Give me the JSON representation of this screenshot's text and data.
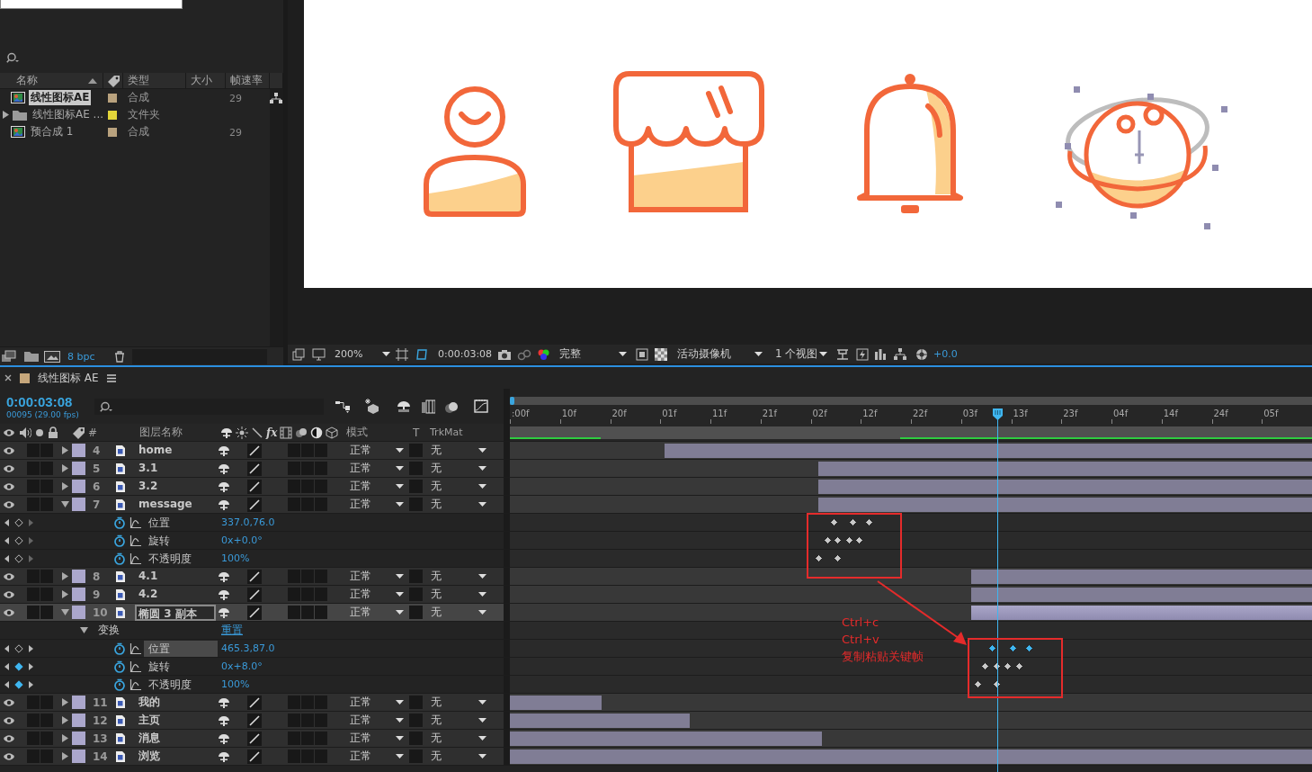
{
  "project": {
    "columns": [
      "名称",
      "类型",
      "大小",
      "帧速率"
    ],
    "items": [
      {
        "kind": "comp",
        "name": "线性图标AE",
        "type": "合成",
        "fps": "29",
        "color": "#b9a27e",
        "selected": true
      },
      {
        "kind": "folder",
        "name": "线性图标AE ...",
        "type": "文件夹",
        "color": "#e3d63a",
        "selected": false,
        "expanded": false
      },
      {
        "kind": "comp",
        "name": "预合成 1",
        "type": "合成",
        "fps": "29",
        "color": "#b9a27e",
        "selected": false
      }
    ],
    "bit_depth": "8 bpc"
  },
  "viewer": {
    "zoom": "200%",
    "timecode": "0:00:03:08",
    "resolution": "完整",
    "camera": "活动摄像机",
    "views": "1 个视图",
    "exposure": "+0.0"
  },
  "timeline": {
    "tab": "线性图标 AE",
    "timecode": "0:00:03:08",
    "frame_info": "00095 (29.00 fps)",
    "columns": {
      "number": "#",
      "name": "图层名称",
      "effects": "fx",
      "mode": "模式",
      "t": "T",
      "trkmat": "TrkMat"
    },
    "ruler": [
      ":00f",
      "10f",
      "20f",
      "01f",
      "11f",
      "21f",
      "02f",
      "12f",
      "22f",
      "03f",
      "13f",
      "23f",
      "04f",
      "14f",
      "24f",
      "05f"
    ],
    "playhead": {
      "level": 0.608
    },
    "rows": [
      {
        "kind": "layer",
        "number": "4",
        "name": "home",
        "expanded": false,
        "selected": false,
        "renaming": false,
        "mode": "正常",
        "trkmat": "无",
        "bar": {
          "level": 0.807,
          "from_end": true
        }
      },
      {
        "kind": "layer",
        "number": "5",
        "name": "3.1",
        "expanded": false,
        "selected": false,
        "renaming": false,
        "mode": "正常",
        "trkmat": "无",
        "bar": {
          "level": 0.615,
          "from_end": true
        }
      },
      {
        "kind": "layer",
        "number": "6",
        "name": "3.2",
        "expanded": false,
        "selected": false,
        "renaming": false,
        "mode": "正常",
        "trkmat": "无",
        "bar": {
          "level": 0.615,
          "from_end": true
        }
      },
      {
        "kind": "layer",
        "number": "7",
        "name": "message",
        "expanded": true,
        "selected": false,
        "renaming": false,
        "mode": "正常",
        "trkmat": "无",
        "bar": {
          "level": 0.615,
          "from_end": true
        }
      },
      {
        "kind": "property",
        "name": "位置",
        "value": "337.0,76.0",
        "on_keyframe": false,
        "selected": false,
        "keyframes": [
          {
            "level": 0.404,
            "selected": false
          },
          {
            "level": 0.428,
            "selected": false
          },
          {
            "level": 0.448,
            "selected": false
          }
        ]
      },
      {
        "kind": "property",
        "name": "旋转",
        "value": "0x+0.0°",
        "on_keyframe": false,
        "selected": false,
        "keyframes": [
          {
            "level": 0.396,
            "selected": false
          },
          {
            "level": 0.409,
            "selected": false
          },
          {
            "level": 0.423,
            "selected": false
          },
          {
            "level": 0.436,
            "selected": false
          }
        ]
      },
      {
        "kind": "property",
        "name": "不透明度",
        "value": "100%",
        "on_keyframe": false,
        "selected": false,
        "keyframes": [
          {
            "level": 0.385,
            "selected": false
          },
          {
            "level": 0.409,
            "selected": false
          }
        ]
      },
      {
        "kind": "layer",
        "number": "8",
        "name": "4.1",
        "expanded": false,
        "selected": false,
        "renaming": false,
        "mode": "正常",
        "trkmat": "无",
        "bar": {
          "level": 0.425,
          "from_end": true
        }
      },
      {
        "kind": "layer",
        "number": "9",
        "name": "4.2",
        "expanded": false,
        "selected": false,
        "renaming": false,
        "mode": "正常",
        "trkmat": "无",
        "bar": {
          "level": 0.425,
          "from_end": true
        }
      },
      {
        "kind": "layer",
        "number": "10",
        "name": "椭圆 3 副本",
        "expanded": true,
        "selected": true,
        "renaming": true,
        "mode": "正常",
        "trkmat": "无",
        "bar": {
          "level": 0.425,
          "from_end": true
        }
      },
      {
        "kind": "group",
        "name": "变换",
        "action": "重置",
        "expanded": true
      },
      {
        "kind": "property",
        "name": "位置",
        "value": "465.3,87.0",
        "on_keyframe": false,
        "selected": true,
        "keyframes": [
          {
            "level": 0.602,
            "selected": true
          },
          {
            "level": 0.627,
            "selected": true
          },
          {
            "level": 0.647,
            "selected": true
          }
        ]
      },
      {
        "kind": "property",
        "name": "旋转",
        "value": "0x+8.0°",
        "on_keyframe": true,
        "selected": false,
        "keyframes": [
          {
            "level": 0.593,
            "selected": false
          },
          {
            "level": 0.607,
            "selected": false
          },
          {
            "level": 0.62,
            "selected": false
          },
          {
            "level": 0.635,
            "selected": false
          }
        ]
      },
      {
        "kind": "property",
        "name": "不透明度",
        "value": "100%",
        "on_keyframe": true,
        "selected": false,
        "keyframes": [
          {
            "level": 0.583,
            "selected": false
          },
          {
            "level": 0.607,
            "selected": false
          }
        ]
      },
      {
        "kind": "layer",
        "number": "11",
        "name": "我的",
        "expanded": false,
        "selected": false,
        "renaming": false,
        "mode": "正常",
        "trkmat": "无",
        "bar": {
          "level": 0.114,
          "from_end": false
        }
      },
      {
        "kind": "layer",
        "number": "12",
        "name": "主页",
        "expanded": false,
        "selected": false,
        "renaming": false,
        "mode": "正常",
        "trkmat": "无",
        "bar": {
          "level": 0.224,
          "from_end": false
        }
      },
      {
        "kind": "layer",
        "number": "13",
        "name": "消息",
        "expanded": false,
        "selected": false,
        "renaming": false,
        "mode": "正常",
        "trkmat": "无",
        "bar": {
          "level": 0.389,
          "from_end": false
        }
      },
      {
        "kind": "layer",
        "number": "14",
        "name": "浏览",
        "expanded": false,
        "selected": false,
        "renaming": false,
        "mode": "正常",
        "trkmat": "无",
        "bar": {
          "level": 1.0
        }
      }
    ],
    "annotation": [
      "Ctrl+c",
      "Ctrl+v",
      "复制粘贴关键帧"
    ]
  }
}
